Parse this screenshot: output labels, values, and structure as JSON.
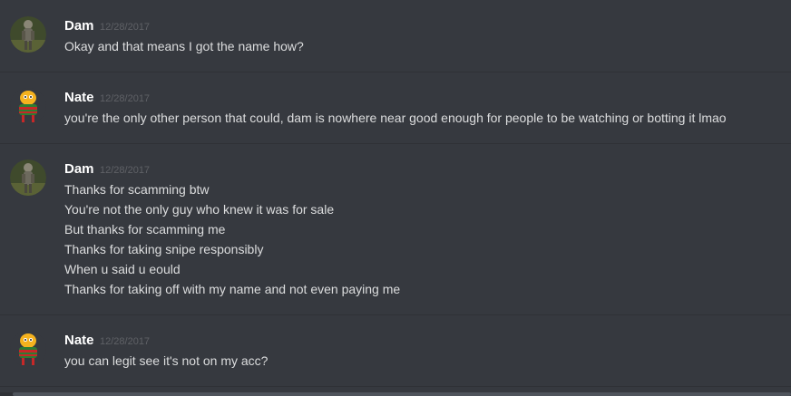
{
  "messages": [
    {
      "username": "Dam",
      "timestamp": "12/28/2017",
      "avatar_icon": "dam-avatar-icon",
      "lines": [
        "Okay and that means I got the name how?"
      ]
    },
    {
      "username": "Nate",
      "timestamp": "12/28/2017",
      "avatar_icon": "nate-avatar-icon",
      "lines": [
        "you're the only other person that could, dam is nowhere near good enough for people to be watching or botting it lmao"
      ]
    },
    {
      "username": "Dam",
      "timestamp": "12/28/2017",
      "avatar_icon": "dam-avatar-icon",
      "lines": [
        "Thanks for scamming btw",
        "You're not the only guy who knew it was for sale",
        "But thanks for scamming me",
        "Thanks for taking snipe responsibly",
        "When u said u eould",
        "Thanks for taking off with my name and not even paying me"
      ]
    },
    {
      "username": "Nate",
      "timestamp": "12/28/2017",
      "avatar_icon": "nate-avatar-icon",
      "lines": [
        "you can legit see it's not on my acc?"
      ]
    }
  ],
  "colors": {
    "background": "#36393f",
    "username": "#ffffff",
    "timestamp": "#5f6166",
    "message_text": "#dcddde",
    "divider": "#2f3136"
  }
}
